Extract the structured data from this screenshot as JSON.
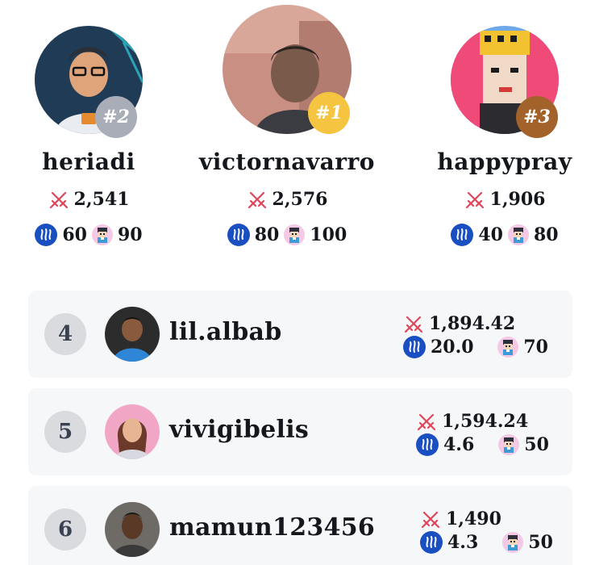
{
  "colors": {
    "gold": "#f5c542",
    "silver": "#a8adb7",
    "bronze": "#a2622a",
    "steem": "#1a4fc2",
    "sword": "#e0465a",
    "row_bg": "#f6f7f9",
    "rank_circle": "#d9dbdf"
  },
  "podium": [
    {
      "place": "#2",
      "name": "heriadi",
      "score": "2,541",
      "steem": "60",
      "mascot": "90"
    },
    {
      "place": "#1",
      "name": "victornavarro",
      "score": "2,576",
      "steem": "80",
      "mascot": "100"
    },
    {
      "place": "#3",
      "name": "happypray",
      "score": "1,906",
      "steem": "40",
      "mascot": "80"
    }
  ],
  "rows": [
    {
      "rank": "4",
      "name": "lil.albab",
      "score": "1,894.42",
      "steem": "20.0",
      "mascot": "70"
    },
    {
      "rank": "5",
      "name": "vivigibelis",
      "score": "1,594.24",
      "steem": "4.6",
      "mascot": "50"
    },
    {
      "rank": "6",
      "name": "mamun123456",
      "score": "1,490",
      "steem": "4.3",
      "mascot": "50"
    }
  ],
  "icons": {
    "score": "crossed-swords-icon",
    "steem": "steem-coin-icon",
    "mascot": "mascot-token-icon"
  }
}
